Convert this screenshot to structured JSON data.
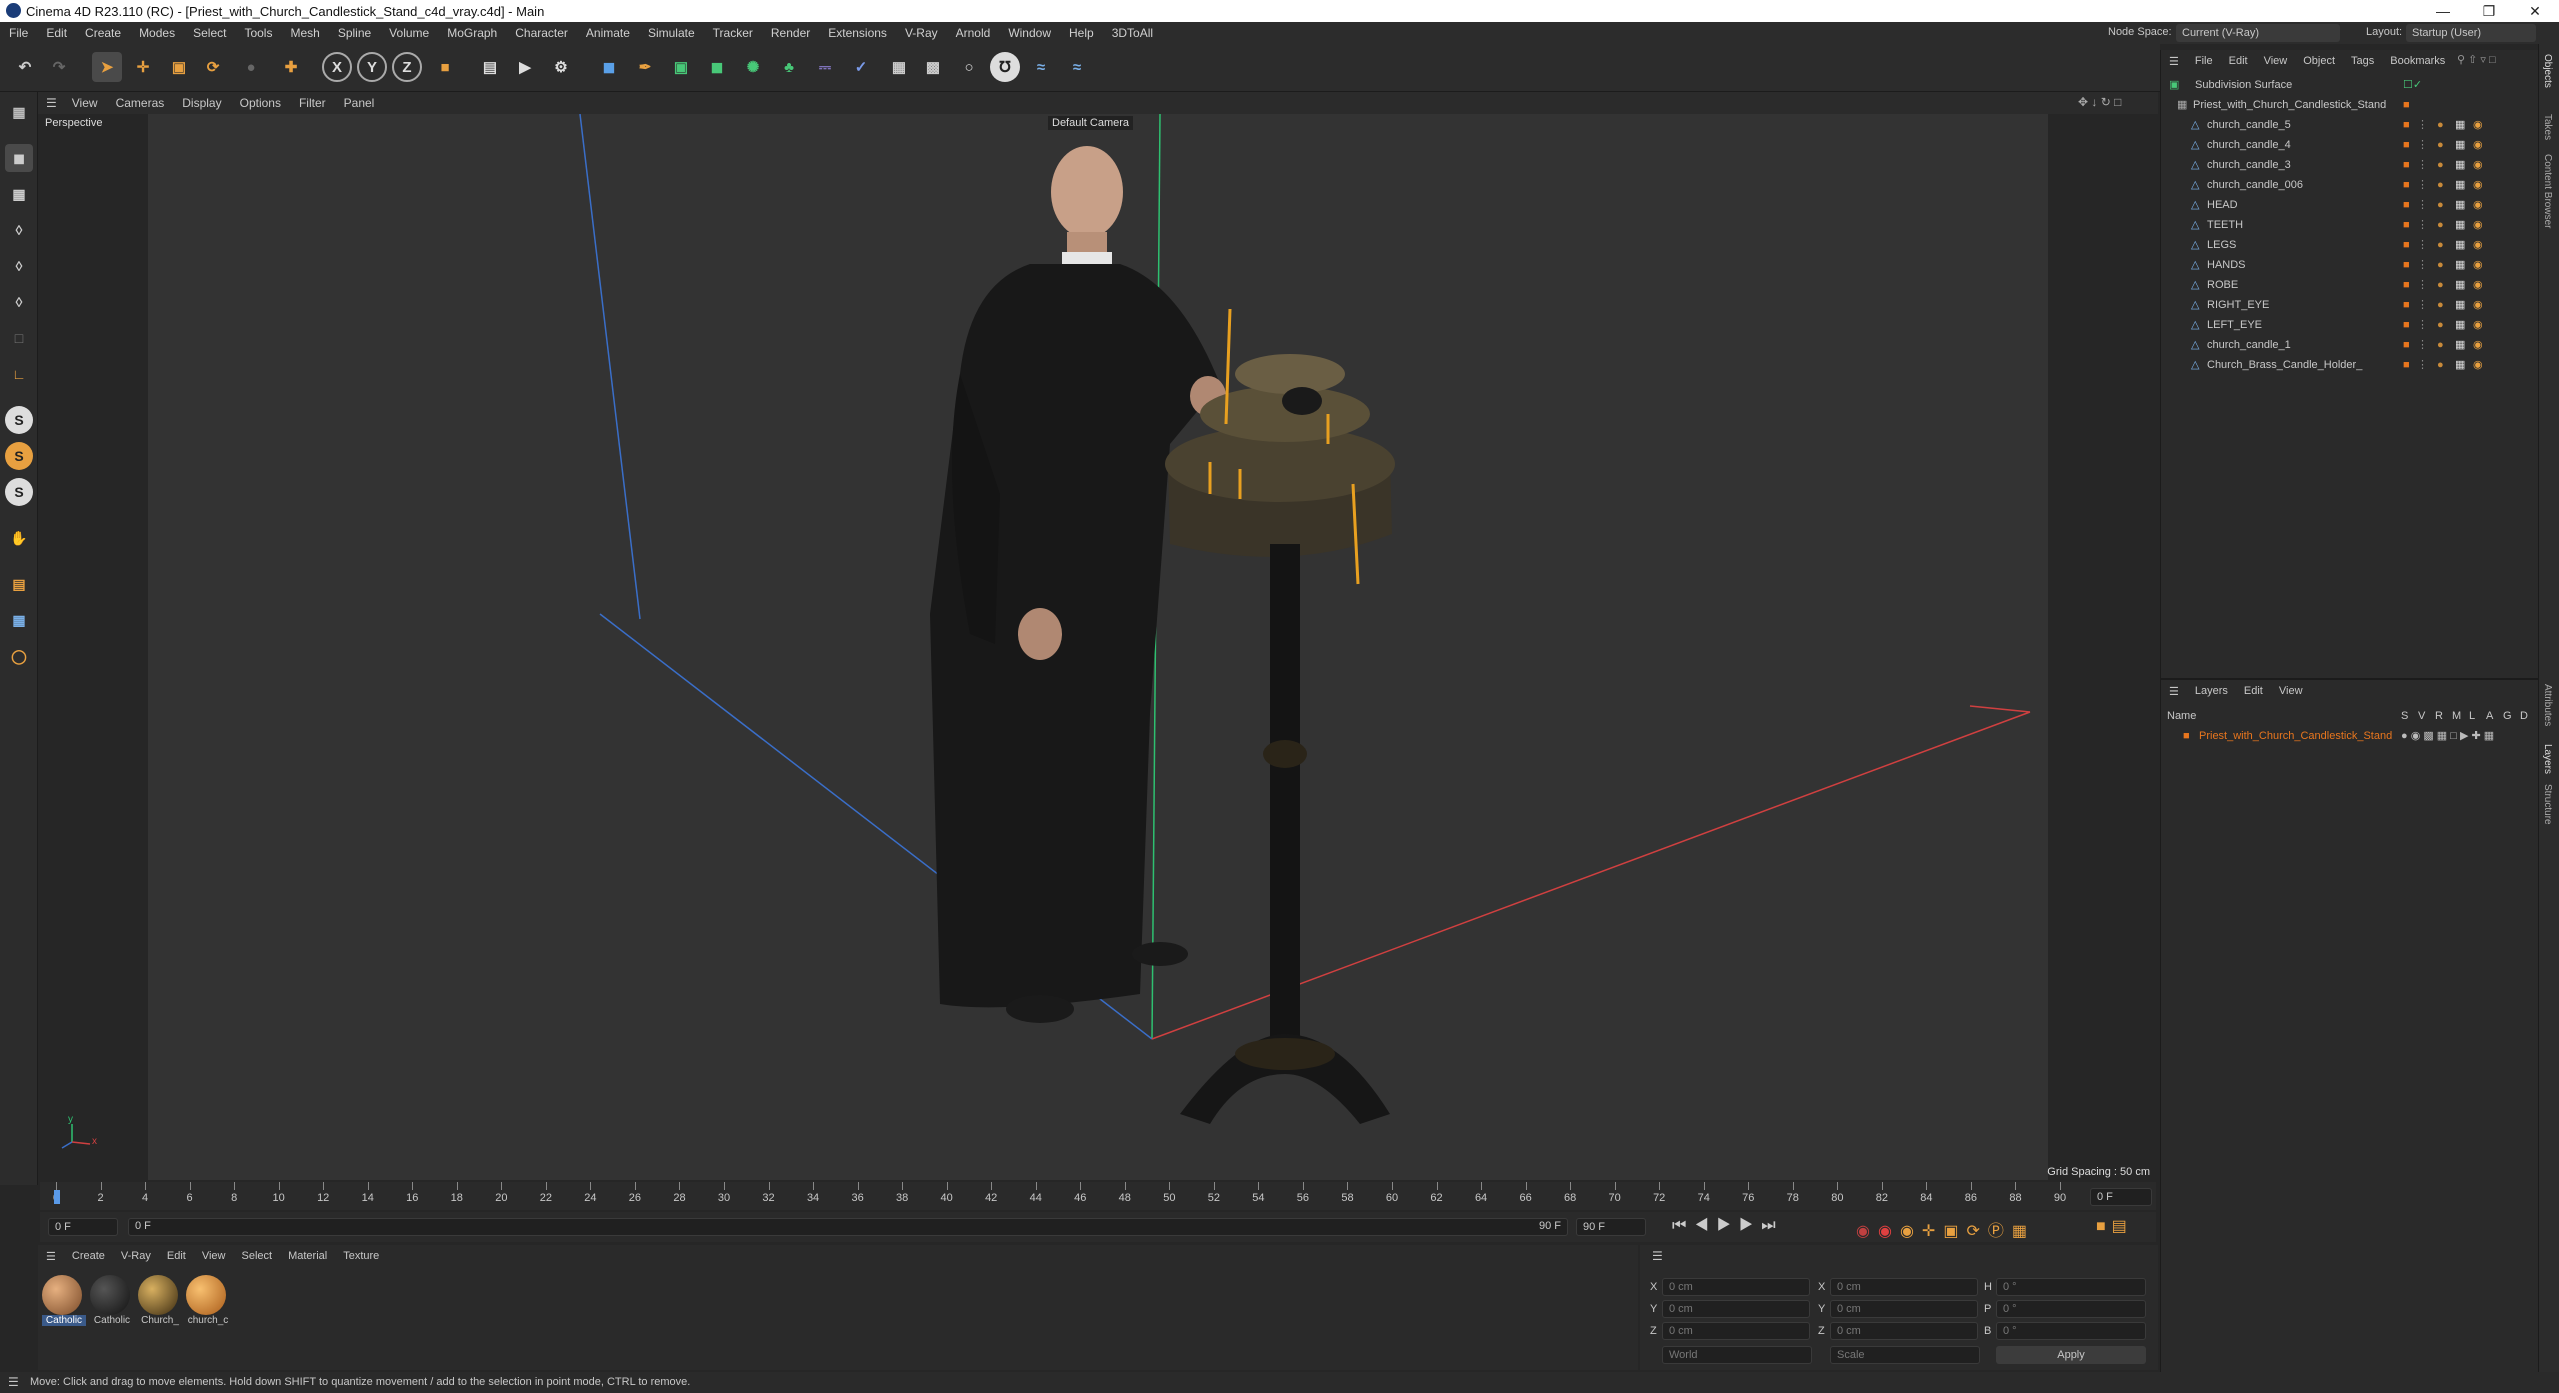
{
  "window": {
    "title": "Cinema 4D R23.110 (RC) - [Priest_with_Church_Candlestick_Stand_c4d_vray.c4d] - Main"
  },
  "menu": [
    "File",
    "Edit",
    "Create",
    "Modes",
    "Select",
    "Tools",
    "Mesh",
    "Spline",
    "Volume",
    "MoGraph",
    "Character",
    "Animate",
    "Simulate",
    "Tracker",
    "Render",
    "Extensions",
    "V-Ray",
    "Arnold",
    "Window",
    "Help",
    "3DToAll"
  ],
  "nodespace": {
    "label": "Node Space:",
    "value": "Current (V-Ray)"
  },
  "layout": {
    "label": "Layout:",
    "value": "Startup (User)"
  },
  "viewport": {
    "menu": [
      "View",
      "Cameras",
      "Display",
      "Options",
      "Filter",
      "Panel"
    ],
    "label": "Perspective",
    "camera": "Default Camera",
    "grid_spacing": "Grid Spacing : 50 cm",
    "axis_x": "x",
    "axis_y": "y"
  },
  "timeline": {
    "ticks": [
      "0",
      "2",
      "4",
      "6",
      "8",
      "10",
      "12",
      "14",
      "16",
      "18",
      "20",
      "22",
      "24",
      "26",
      "28",
      "30",
      "32",
      "34",
      "36",
      "38",
      "40",
      "42",
      "44",
      "46",
      "48",
      "50",
      "52",
      "54",
      "56",
      "58",
      "60",
      "62",
      "64",
      "66",
      "68",
      "70",
      "72",
      "74",
      "76",
      "78",
      "80",
      "82",
      "84",
      "86",
      "88",
      "90"
    ],
    "current_frame": "0 F"
  },
  "transport": {
    "start": "0 F",
    "current": "0 F",
    "end": "90 F",
    "end2": "90 F"
  },
  "materials": {
    "menu": [
      "Create",
      "V-Ray",
      "Edit",
      "View",
      "Select",
      "Material",
      "Texture"
    ],
    "items": [
      {
        "label": "Catholic",
        "color": "#b07a4c"
      },
      {
        "label": "Catholic",
        "color": "#262626"
      },
      {
        "label": "Church_",
        "color": "#8a6a2c"
      },
      {
        "label": "church_c",
        "color": "#d88a2c"
      }
    ]
  },
  "attributes": {
    "x_label": "X",
    "y_label": "Y",
    "z_label": "Z",
    "h_label": "H",
    "p_label": "P",
    "b_label": "B",
    "x": "0 cm",
    "y": "0 cm",
    "z": "0 cm",
    "x2": "0 cm",
    "y2": "0 cm",
    "z2": "0 cm",
    "h": "0 °",
    "p": "0 °",
    "b": "0 °",
    "coord": "World",
    "mode": "Scale",
    "apply": "Apply"
  },
  "objects": {
    "menu": [
      "File",
      "Edit",
      "View",
      "Object",
      "Tags",
      "Bookmarks"
    ],
    "root": "Subdivision Surface",
    "group": "Priest_with_Church_Candlestick_Stand",
    "items": [
      "church_candle_5",
      "church_candle_4",
      "church_candle_3",
      "church_candle_006",
      "HEAD",
      "TEETH",
      "LEGS",
      "HANDS",
      "ROBE",
      "RIGHT_EYE",
      "LEFT_EYE",
      "church_candle_1",
      "Church_Brass_Candle_Holder_"
    ]
  },
  "layers": {
    "menu": [
      "Layers",
      "Edit",
      "View"
    ],
    "name_header": "Name",
    "cols": [
      "S",
      "V",
      "R",
      "M",
      "L",
      "A",
      "G",
      "D"
    ],
    "item": "Priest_with_Church_Candlestick_Stand"
  },
  "sidetabs": [
    "Objects",
    "Takes",
    "Content Browser",
    "Attributes",
    "Layers",
    "Structure"
  ],
  "status": "Move: Click and drag to move elements. Hold down SHIFT to quantize movement / add to the selection in point mode, CTRL to remove.",
  "colors": {
    "accent": "#e8761e",
    "bg": "#2a2a2a",
    "viewport": "#333333",
    "layer": "#e8761e"
  }
}
